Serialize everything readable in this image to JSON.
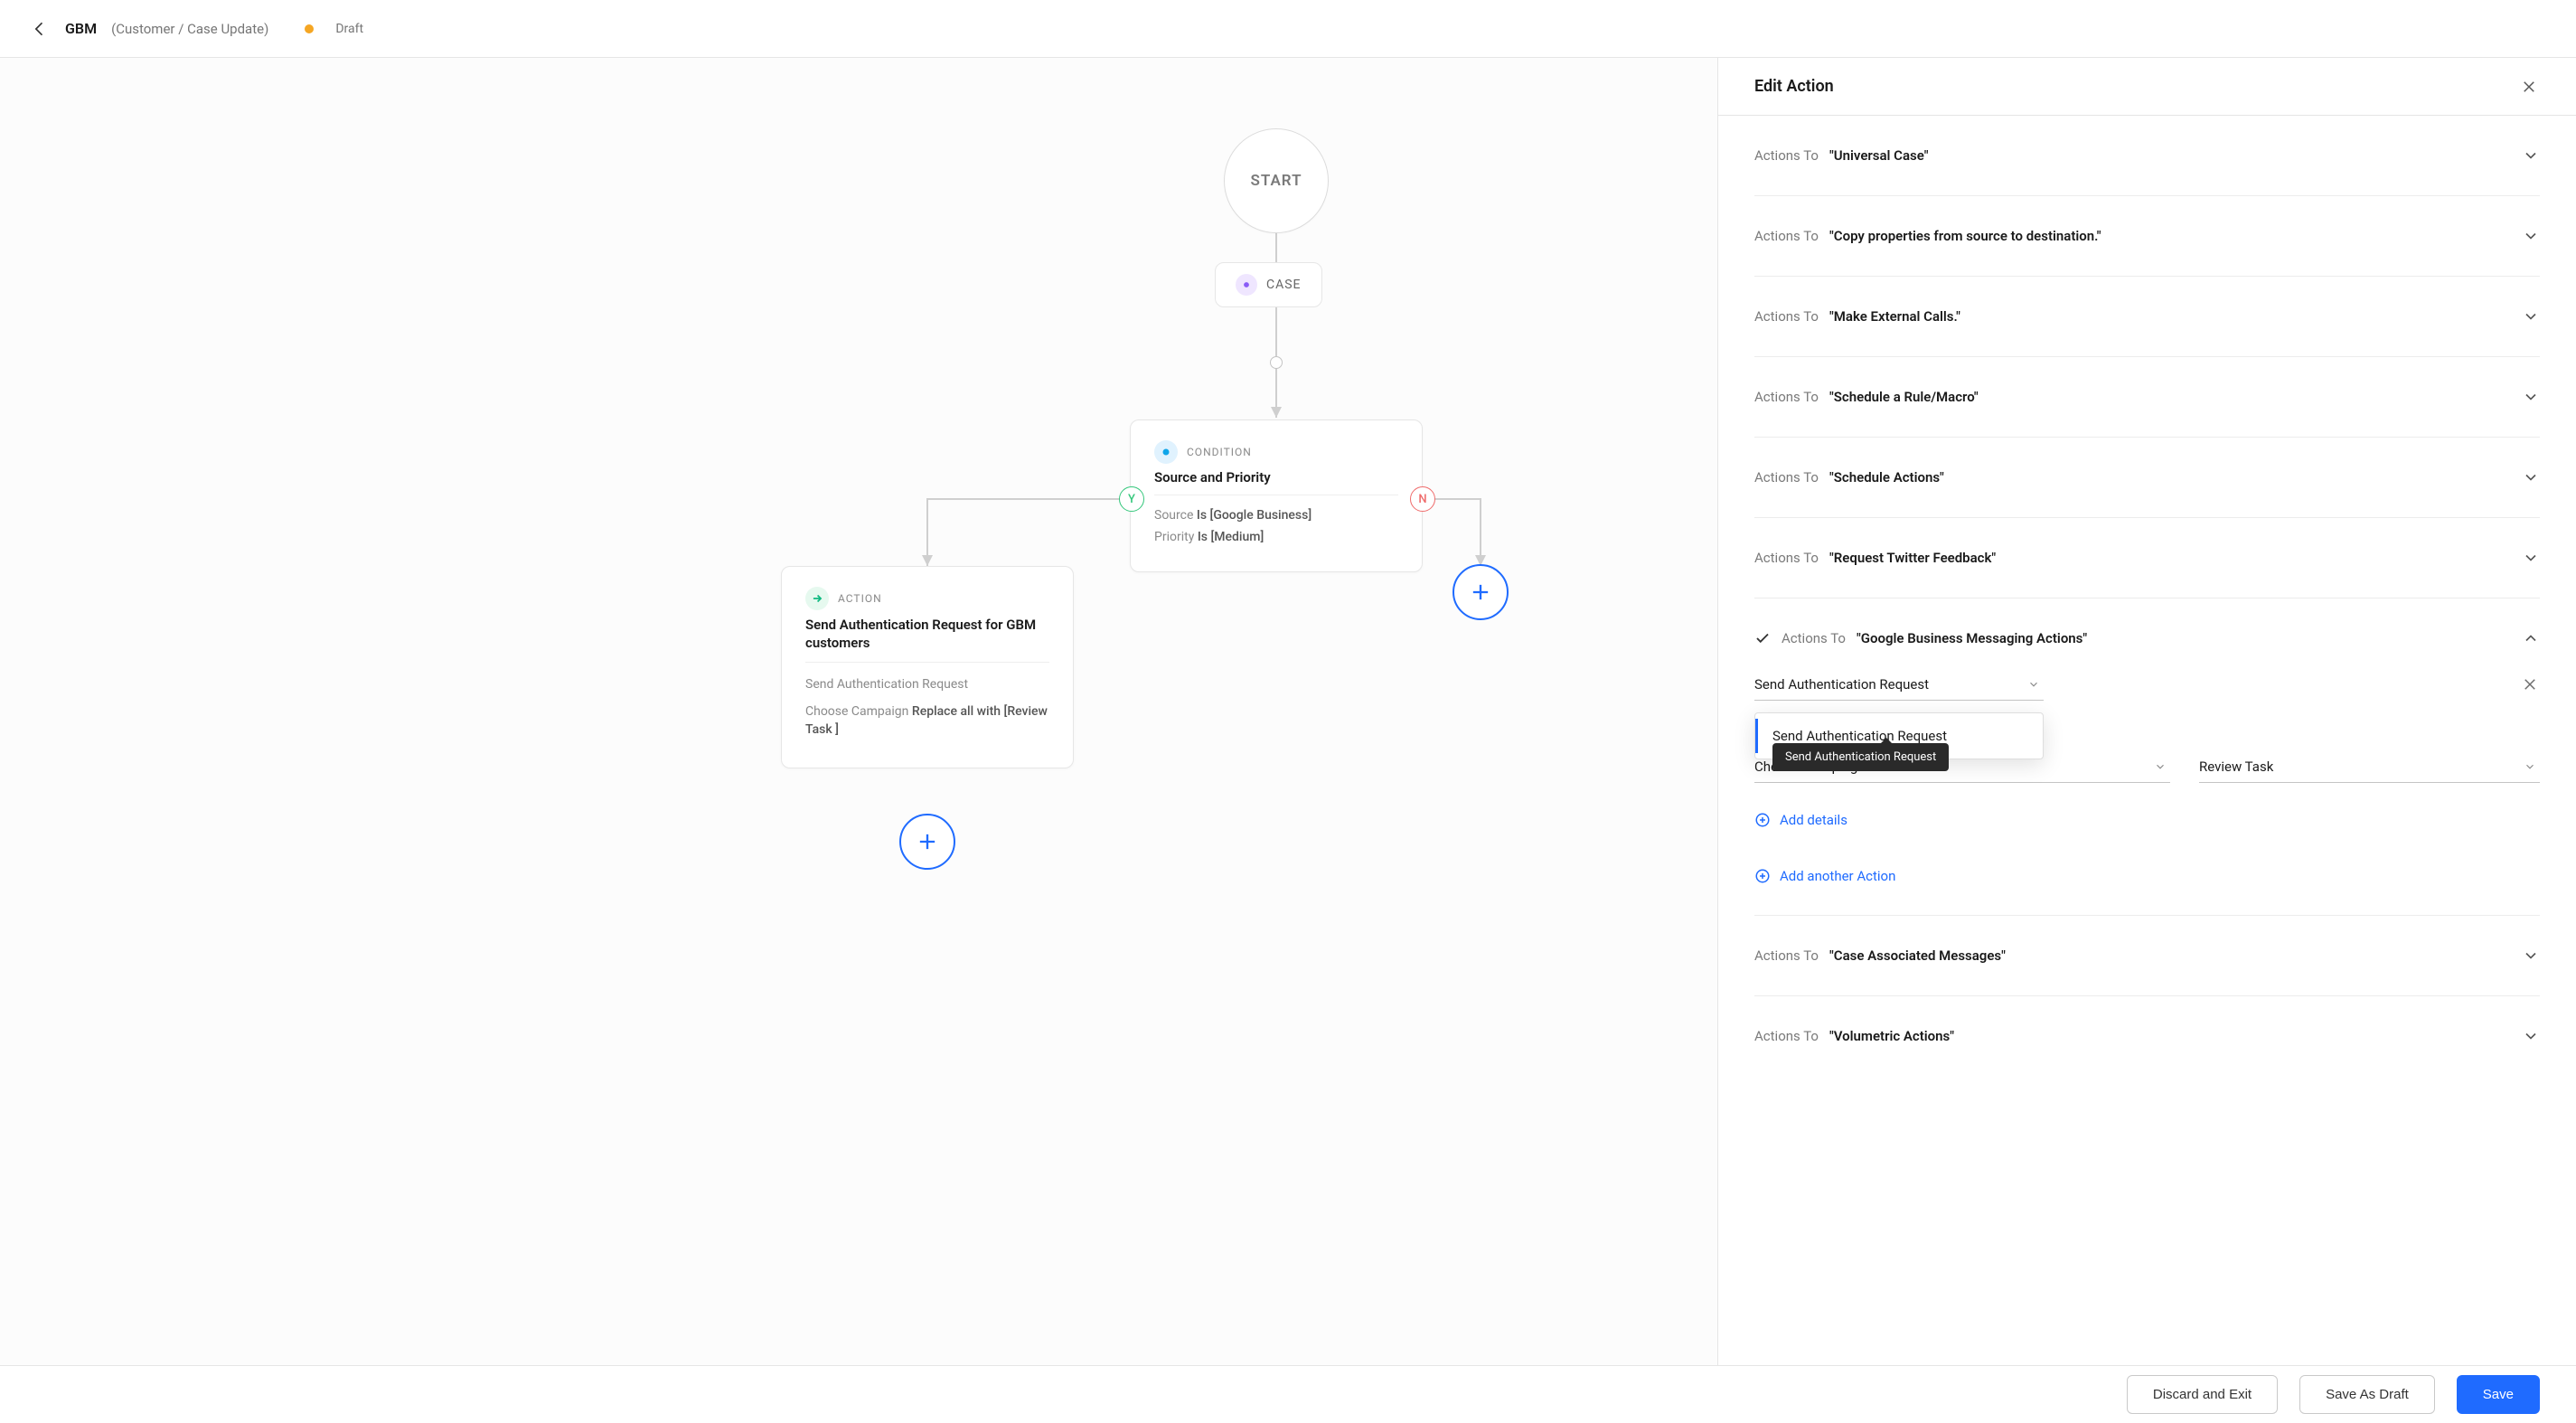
{
  "header": {
    "title": "GBM",
    "breadcrumb": "(Customer / Case Update)",
    "status": "Draft"
  },
  "side_panel": {
    "title": "Edit Action",
    "action_prefix": "Actions To",
    "groups": [
      {
        "target": "\"Universal Case\""
      },
      {
        "target": "\"Copy properties from source to destination.\""
      },
      {
        "target": "\"Make External Calls.\""
      },
      {
        "target": "\"Schedule a Rule/Macro\""
      },
      {
        "target": "\"Schedule Actions\""
      },
      {
        "target": "\"Request Twitter Feedback\""
      },
      {
        "target": "\"Google Business Messaging Actions\"",
        "checked": true,
        "expanded": true
      },
      {
        "target": "\"Case Associated Messages\""
      },
      {
        "target": "\"Volumetric Actions\""
      }
    ],
    "expanded": {
      "select1": "Send Authentication Request",
      "dropdown_option": "Send Authentication Request",
      "tooltip": "Send Authentication Request",
      "select2": "Choose Campaign Set",
      "select3": "Review Task",
      "add_details": "Add details",
      "add_action": "Add another Action"
    }
  },
  "footer": {
    "discard": "Discard and Exit",
    "save_draft": "Save As Draft",
    "save": "Save"
  },
  "flow": {
    "start": "START",
    "case_label": "CASE",
    "condition": {
      "type": "CONDITION",
      "title": "Source and Priority",
      "rule1_field": "Source",
      "rule1_rest": "Is [Google Business]",
      "rule2_field": "Priority",
      "rule2_rest": "Is [Medium]"
    },
    "action": {
      "type": "ACTION",
      "title": "Send Authentication Request for GBM customers",
      "line1": "Send Authentication Request",
      "line2_a": "Choose Campaign",
      "line2_b": "Replace all with [Review Task ]"
    },
    "branch_y": "Y",
    "branch_n": "N"
  }
}
